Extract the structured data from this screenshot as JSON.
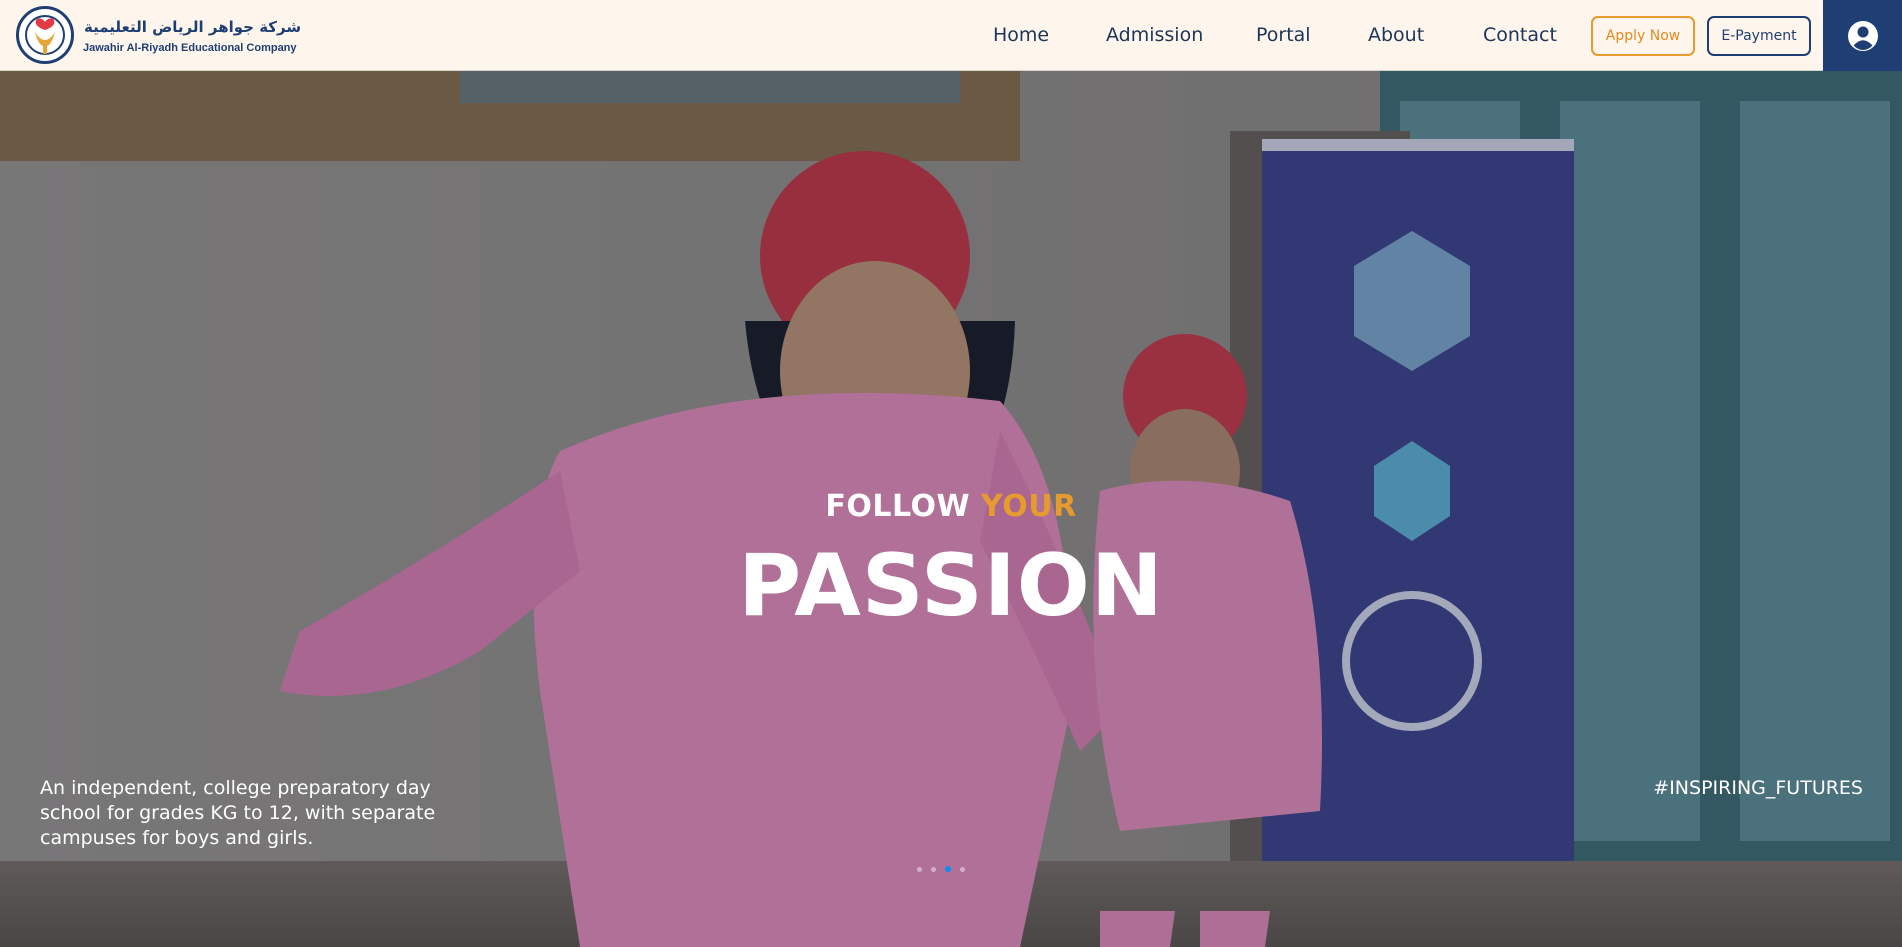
{
  "header": {
    "logo_arabic": "شركة جواهر الرياض التعليمية",
    "logo_english": "Jawahir Al-Riyadh Educational Company",
    "nav": [
      {
        "label": "Home"
      },
      {
        "label": "Admission"
      },
      {
        "label": "Portal"
      },
      {
        "label": "About"
      },
      {
        "label": "Contact"
      }
    ],
    "apply_label": "Apply Now",
    "payment_label": "E-Payment",
    "user_icon": "user-circle-icon"
  },
  "hero": {
    "line1_white": "FOLLOW",
    "line1_accent": "YOUR",
    "headline": "PASSION",
    "description": "An independent, college preparatory day school for grades KG to 12, with separate campuses for boys and girls.",
    "hashtag": "#INSPIRING_FUTURES",
    "slides_total": 4,
    "active_slide": 3
  },
  "colors": {
    "brand_navy": "#1f3f74",
    "accent_orange": "#e79a2d",
    "header_bg": "#fef6ec"
  }
}
